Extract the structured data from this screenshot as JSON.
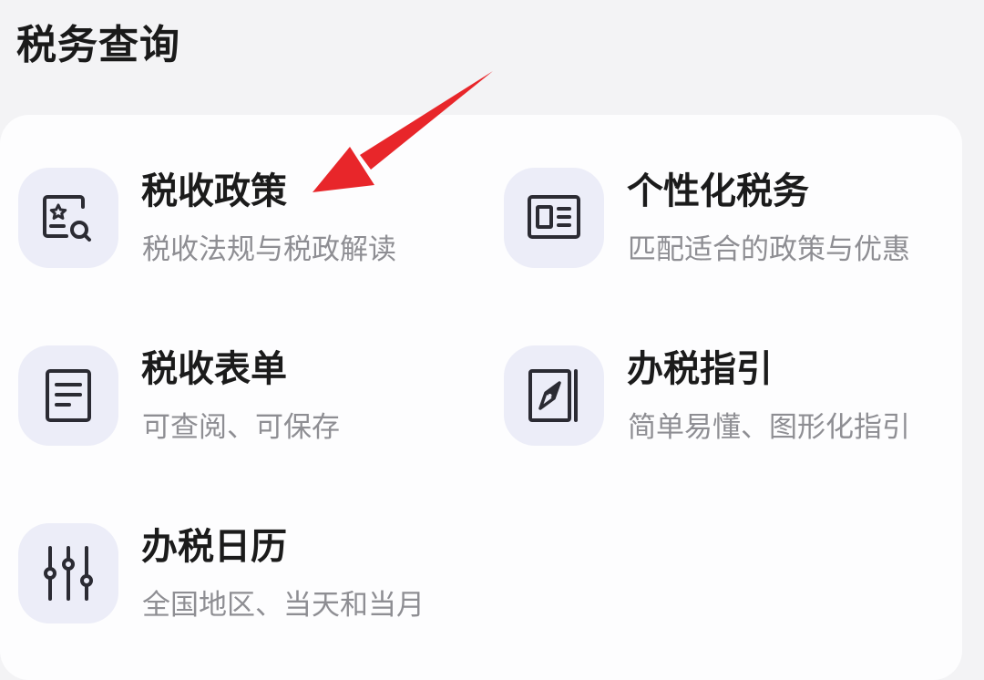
{
  "section": {
    "title": "税务查询"
  },
  "items": [
    {
      "title": "税收政策",
      "subtitle": "税收法规与税政解读",
      "icon": "policy-search-icon"
    },
    {
      "title": "个性化税务",
      "subtitle": "匹配适合的政策与优惠",
      "icon": "id-card-icon"
    },
    {
      "title": "税收表单",
      "subtitle": "可查阅、可保存",
      "icon": "document-list-icon"
    },
    {
      "title": "办税指引",
      "subtitle": "简单易懂、图形化指引",
      "icon": "compass-book-icon"
    },
    {
      "title": "办税日历",
      "subtitle": "全国地区、当天和当月",
      "icon": "sliders-icon"
    }
  ],
  "colors": {
    "icon_bg": "#ecedf8",
    "icon_stroke": "#2b2b33",
    "annotation_arrow": "#e8262a"
  }
}
